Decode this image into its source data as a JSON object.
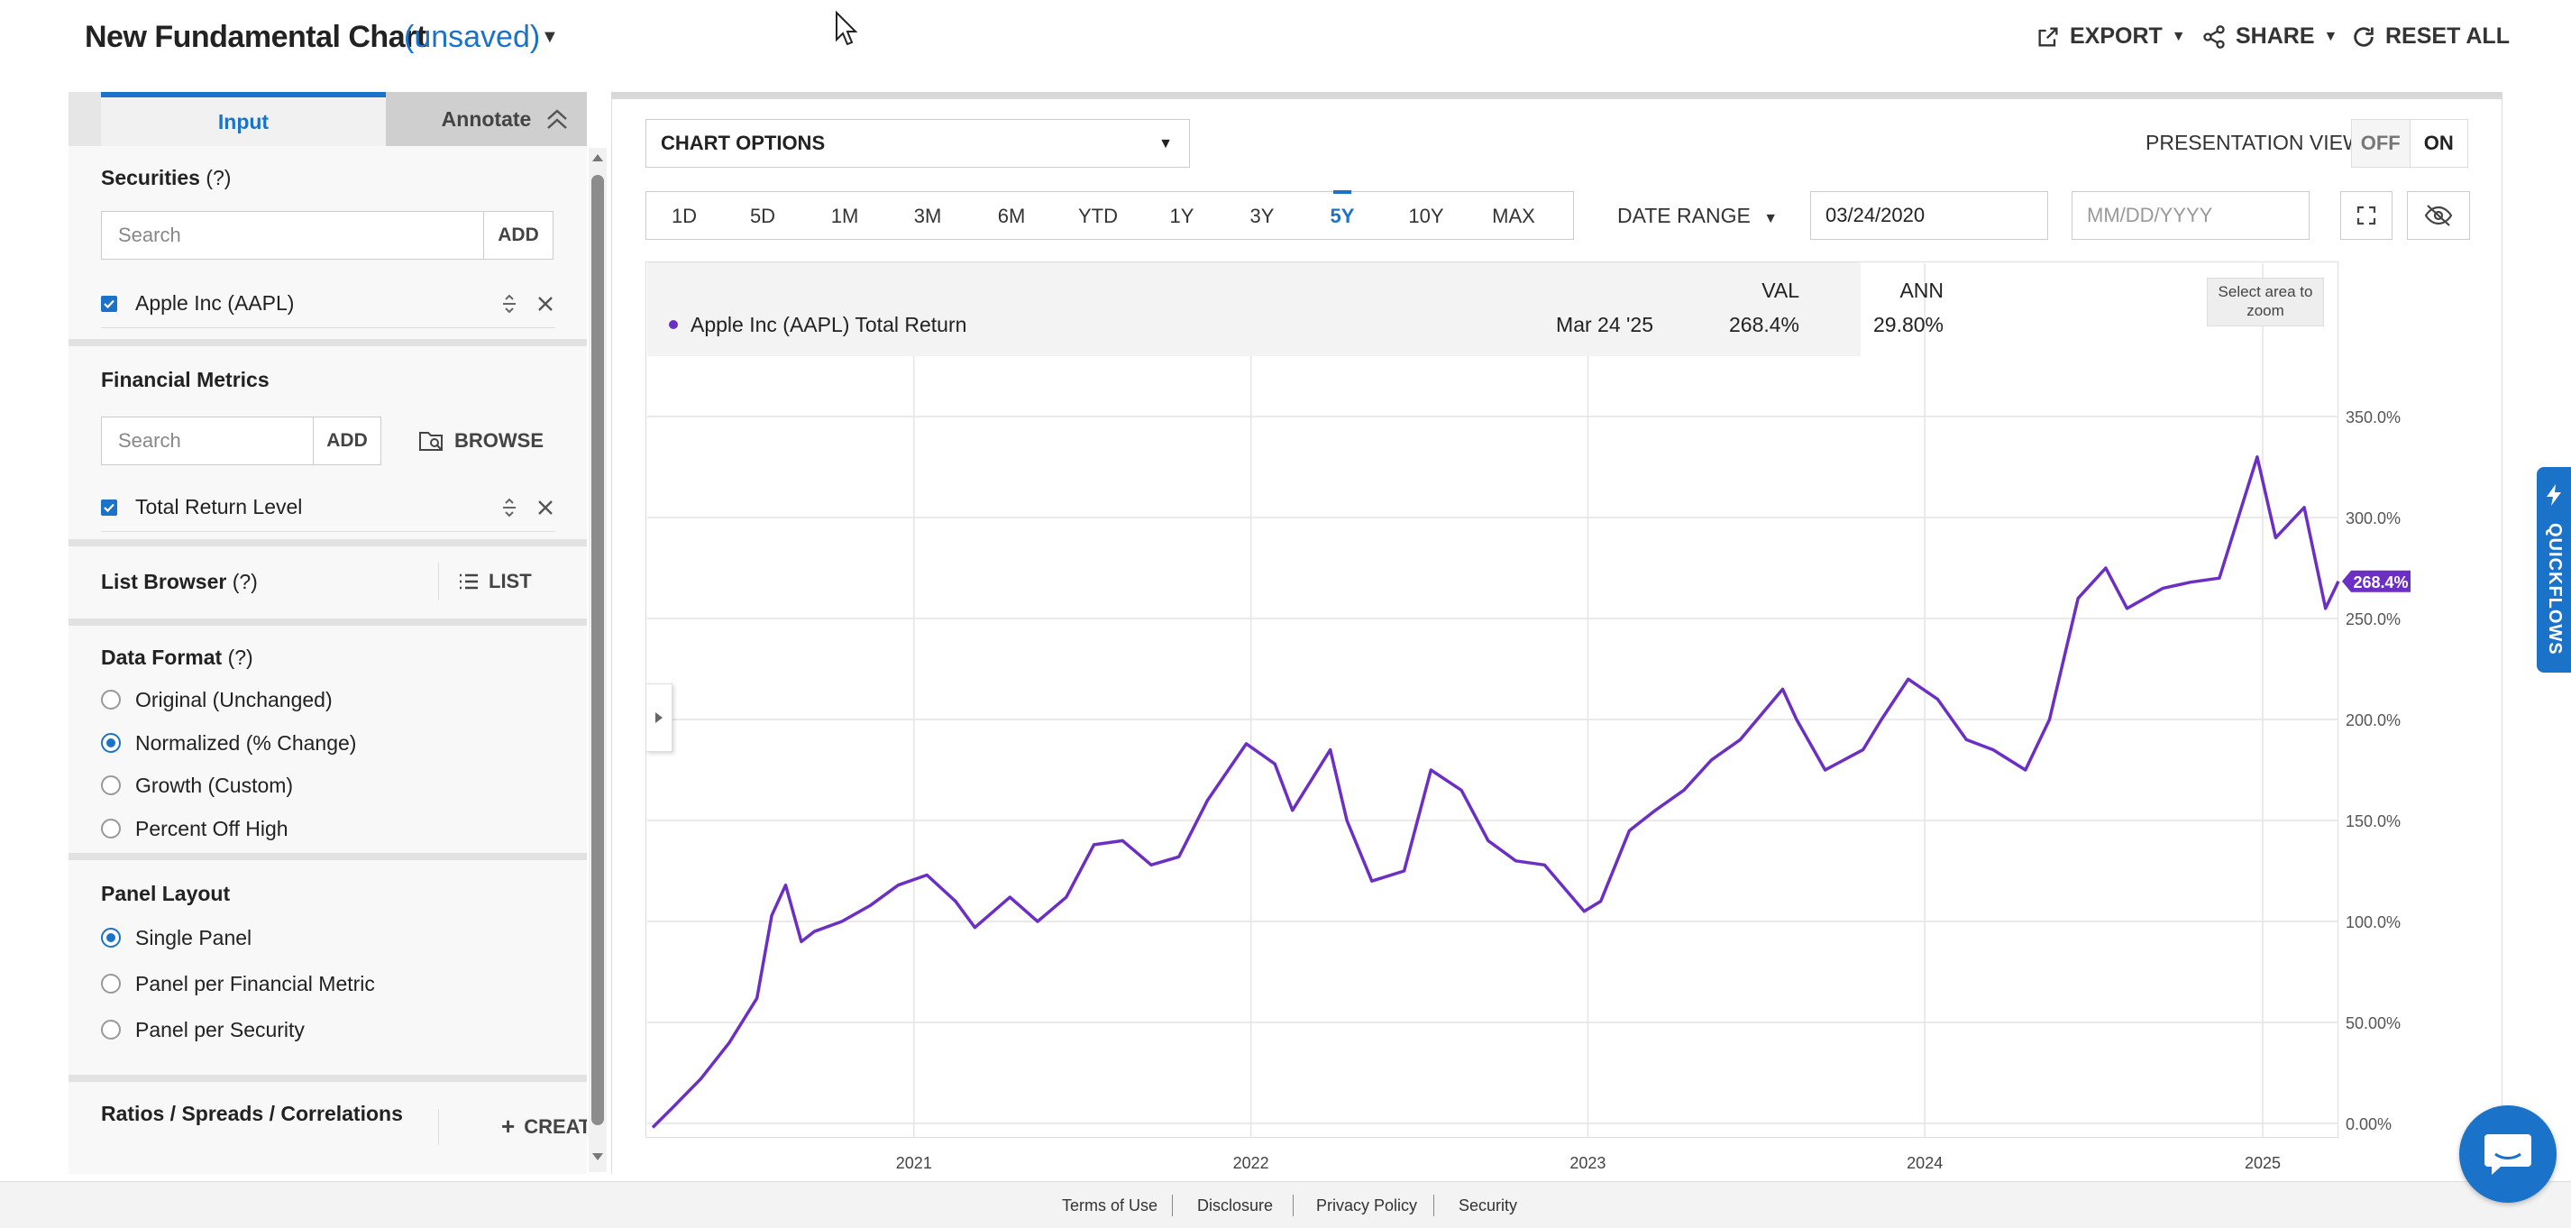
{
  "header": {
    "title": "New Fundamental Chart",
    "unsaved": "(unsaved)",
    "export_label": "EXPORT",
    "share_label": "SHARE",
    "reset_label": "RESET ALL"
  },
  "left_panel": {
    "tabs": [
      "Input",
      "Annotate"
    ],
    "securities": {
      "title": "Securities",
      "help": "(?)",
      "search_placeholder": "Search",
      "add_label": "ADD",
      "items": [
        "Apple Inc (AAPL)"
      ]
    },
    "financial_metrics": {
      "title": "Financial Metrics",
      "search_placeholder": "Search",
      "add_label": "ADD",
      "browse_label": "BROWSE",
      "items": [
        "Total Return Level"
      ]
    },
    "list_browser": {
      "title": "List Browser",
      "help": "(?)",
      "list_label": "LIST"
    },
    "data_format": {
      "title": "Data Format",
      "help": "(?)",
      "options": [
        "Original (Unchanged)",
        "Normalized (% Change)",
        "Growth (Custom)",
        "Percent Off High"
      ],
      "selected": "Normalized (% Change)"
    },
    "panel_layout": {
      "title": "Panel Layout",
      "options": [
        "Single Panel",
        "Panel per Financial Metric",
        "Panel per Security"
      ],
      "selected": "Single Panel"
    },
    "ratios": {
      "title": "Ratios / Spreads / Correlations",
      "create_label": "CREATE"
    }
  },
  "chart_controls": {
    "chart_options_label": "CHART OPTIONS",
    "presentation_label": "PRESENTATION VIEW",
    "toggle_off": "OFF",
    "toggle_on": "ON",
    "ranges": [
      "1D",
      "5D",
      "1M",
      "3M",
      "6M",
      "YTD",
      "1Y",
      "3Y",
      "5Y",
      "10Y",
      "MAX"
    ],
    "active_range": "5Y",
    "date_range_label": "DATE RANGE",
    "start_date": "03/24/2020",
    "end_placeholder": "MM/DD/YYYY"
  },
  "legend": {
    "series_name": "Apple Inc (AAPL) Total Return",
    "date": "Mar 24 '25",
    "val_header": "VAL",
    "ann_header": "ANN",
    "val": "268.4%",
    "ann": "29.80%",
    "zoom_hint": "Select area to zoom"
  },
  "chart_data": {
    "type": "line",
    "series": [
      {
        "name": "Apple Inc (AAPL) Total Return",
        "color": "#6b2fc4",
        "x": [
          "2020-03-24",
          "2020-04-15",
          "2020-05-15",
          "2020-06-15",
          "2020-07-15",
          "2020-07-31",
          "2020-08-15",
          "2020-09-01",
          "2020-09-15",
          "2020-10-15",
          "2020-11-15",
          "2020-12-15",
          "2021-01-15",
          "2021-02-15",
          "2021-03-08",
          "2021-04-15",
          "2021-05-15",
          "2021-06-15",
          "2021-07-15",
          "2021-08-15",
          "2021-09-15",
          "2021-10-15",
          "2021-11-15",
          "2021-12-27",
          "2022-01-27",
          "2022-02-15",
          "2022-03-28",
          "2022-04-15",
          "2022-05-12",
          "2022-06-16",
          "2022-07-15",
          "2022-08-17",
          "2022-09-15",
          "2022-10-15",
          "2022-11-15",
          "2022-12-28",
          "2023-01-15",
          "2023-02-15",
          "2023-03-15",
          "2023-04-15",
          "2023-05-15",
          "2023-06-15",
          "2023-07-31",
          "2023-08-15",
          "2023-09-15",
          "2023-10-26",
          "2023-11-15",
          "2023-12-14",
          "2024-01-15",
          "2024-02-15",
          "2024-03-15",
          "2024-04-19",
          "2024-05-15",
          "2024-06-15",
          "2024-07-15",
          "2024-08-07",
          "2024-09-15",
          "2024-10-15",
          "2024-11-15",
          "2024-12-26",
          "2025-01-15",
          "2025-02-15",
          "2025-03-10",
          "2025-03-24"
        ],
        "values": [
          -2,
          8,
          22,
          40,
          62,
          103,
          118,
          90,
          95,
          100,
          108,
          118,
          123,
          110,
          97,
          112,
          100,
          112,
          138,
          140,
          128,
          132,
          160,
          188,
          178,
          155,
          185,
          150,
          120,
          125,
          175,
          165,
          140,
          130,
          128,
          105,
          110,
          145,
          155,
          165,
          180,
          190,
          215,
          200,
          175,
          185,
          200,
          220,
          210,
          190,
          185,
          175,
          200,
          260,
          275,
          255,
          265,
          268,
          270,
          330,
          290,
          305,
          255,
          268.4
        ]
      }
    ],
    "x_ticks": [
      "2021",
      "2022",
      "2023",
      "2024",
      "2025"
    ],
    "y_ticks": [
      "0.00%",
      "50.00%",
      "100.0%",
      "150.0%",
      "200.0%",
      "250.0%",
      "300.0%",
      "350.0%"
    ],
    "ylim": [
      0,
      350
    ],
    "last_value_label": "268.4%",
    "grid": true
  },
  "footer": {
    "links": [
      "Terms of Use",
      "Disclosure",
      "Privacy Policy",
      "Security"
    ]
  },
  "quickflows_label": "QUICKFLOWS"
}
